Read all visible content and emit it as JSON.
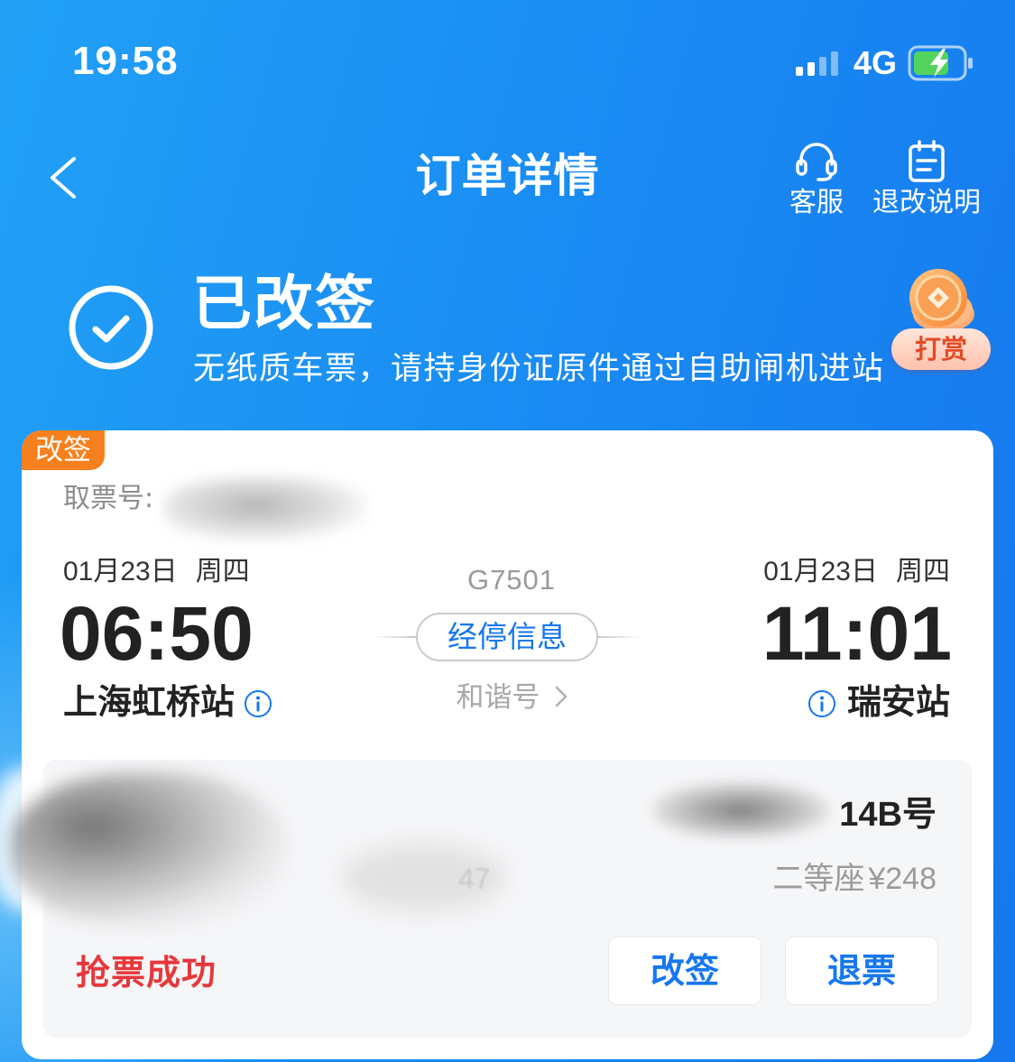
{
  "status_bar": {
    "time": "19:58",
    "network": "4G",
    "icons": [
      "signal-strength-icon",
      "battery-charging-icon"
    ]
  },
  "nav": {
    "back_icon": "chevron-left-icon",
    "title": "订单详情",
    "service_label": "客服",
    "service_icon": "headset-icon",
    "refund_rules_label": "退改说明",
    "refund_rules_icon": "document-icon"
  },
  "order_status": {
    "icon": "check-circle-icon",
    "title": "已改签",
    "subtitle": "无纸质车票，请持身份证原件通过自助闸机进站"
  },
  "reward": {
    "icon": "coin-icon",
    "label": "打赏"
  },
  "ticket": {
    "tag": "改签",
    "pickup_label": "取票号:",
    "departure": {
      "date": "01月23日",
      "weekday": "周四",
      "time": "06:50",
      "station": "上海虹桥站"
    },
    "arrival": {
      "date": "01月23日",
      "weekday": "周四",
      "time": "11:01",
      "station": "瑞安站"
    },
    "train_number": "G7501",
    "stops_button": "经停信息",
    "train_type": "和谐号",
    "seat": {
      "number": "14B号",
      "class": "二等座",
      "price": "¥248",
      "partial_visible_text": "47"
    },
    "grab_status": "抢票成功",
    "actions": {
      "change_label": "改签",
      "refund_label": "退票"
    }
  },
  "colors": {
    "header_blue": "#1a8df3",
    "accent_blue": "#1677ee",
    "tag_orange": "#f7801e",
    "success_red": "#e5383b",
    "panel_gray": "#f5f6f8"
  }
}
